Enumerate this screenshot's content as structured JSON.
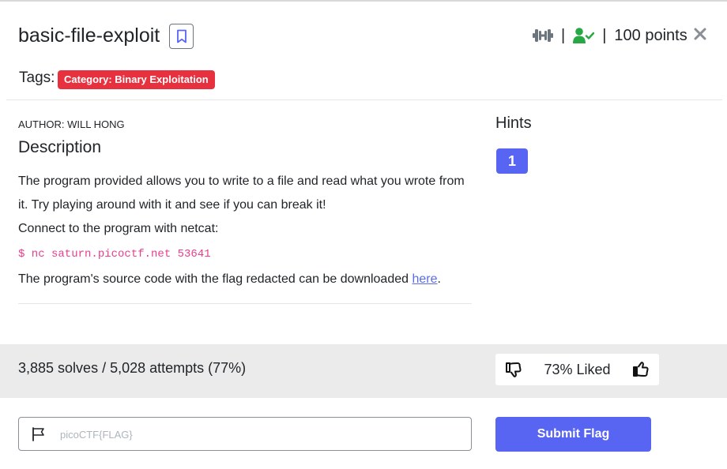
{
  "challenge": {
    "title": "basic-file-exploit",
    "points": "100 points",
    "separator": "|"
  },
  "tags": {
    "label": "Tags:",
    "items": [
      "Category: Binary Exploitation"
    ]
  },
  "description": {
    "author": "AUTHOR: WILL HONG",
    "heading": "Description",
    "line1": "The program provided allows you to write to a file and read what you wrote from it. Try playing around with it and see if you can break it!",
    "line2": "Connect to the program with netcat:",
    "code": "$ nc saturn.picoctf.net 53641",
    "line3_prefix": "The program's source code with the flag redacted can be downloaded ",
    "link_text": "here",
    "line3_suffix": "."
  },
  "hints": {
    "heading": "Hints",
    "buttons": [
      "1"
    ]
  },
  "stats": {
    "solves_text": "3,885 solves / 5,028 attempts (77%)",
    "liked_text": "73% Liked"
  },
  "submit": {
    "placeholder": "picoCTF{FLAG}",
    "button_label": "Submit Flag"
  },
  "colors": {
    "accent": "#5865f2",
    "tag_red": "#e8313f",
    "solved_green": "#28a745",
    "difficulty_gray": "#6c757d",
    "code_pink": "#e83e8c"
  },
  "icons": {
    "bookmark": "bookmark-icon",
    "difficulty": "dumbbell-icon",
    "solved": "user-check-icon",
    "close": "close-icon",
    "thumbs_down": "thumbs-down-icon",
    "thumbs_up": "thumbs-up-icon",
    "flag": "flag-icon"
  }
}
